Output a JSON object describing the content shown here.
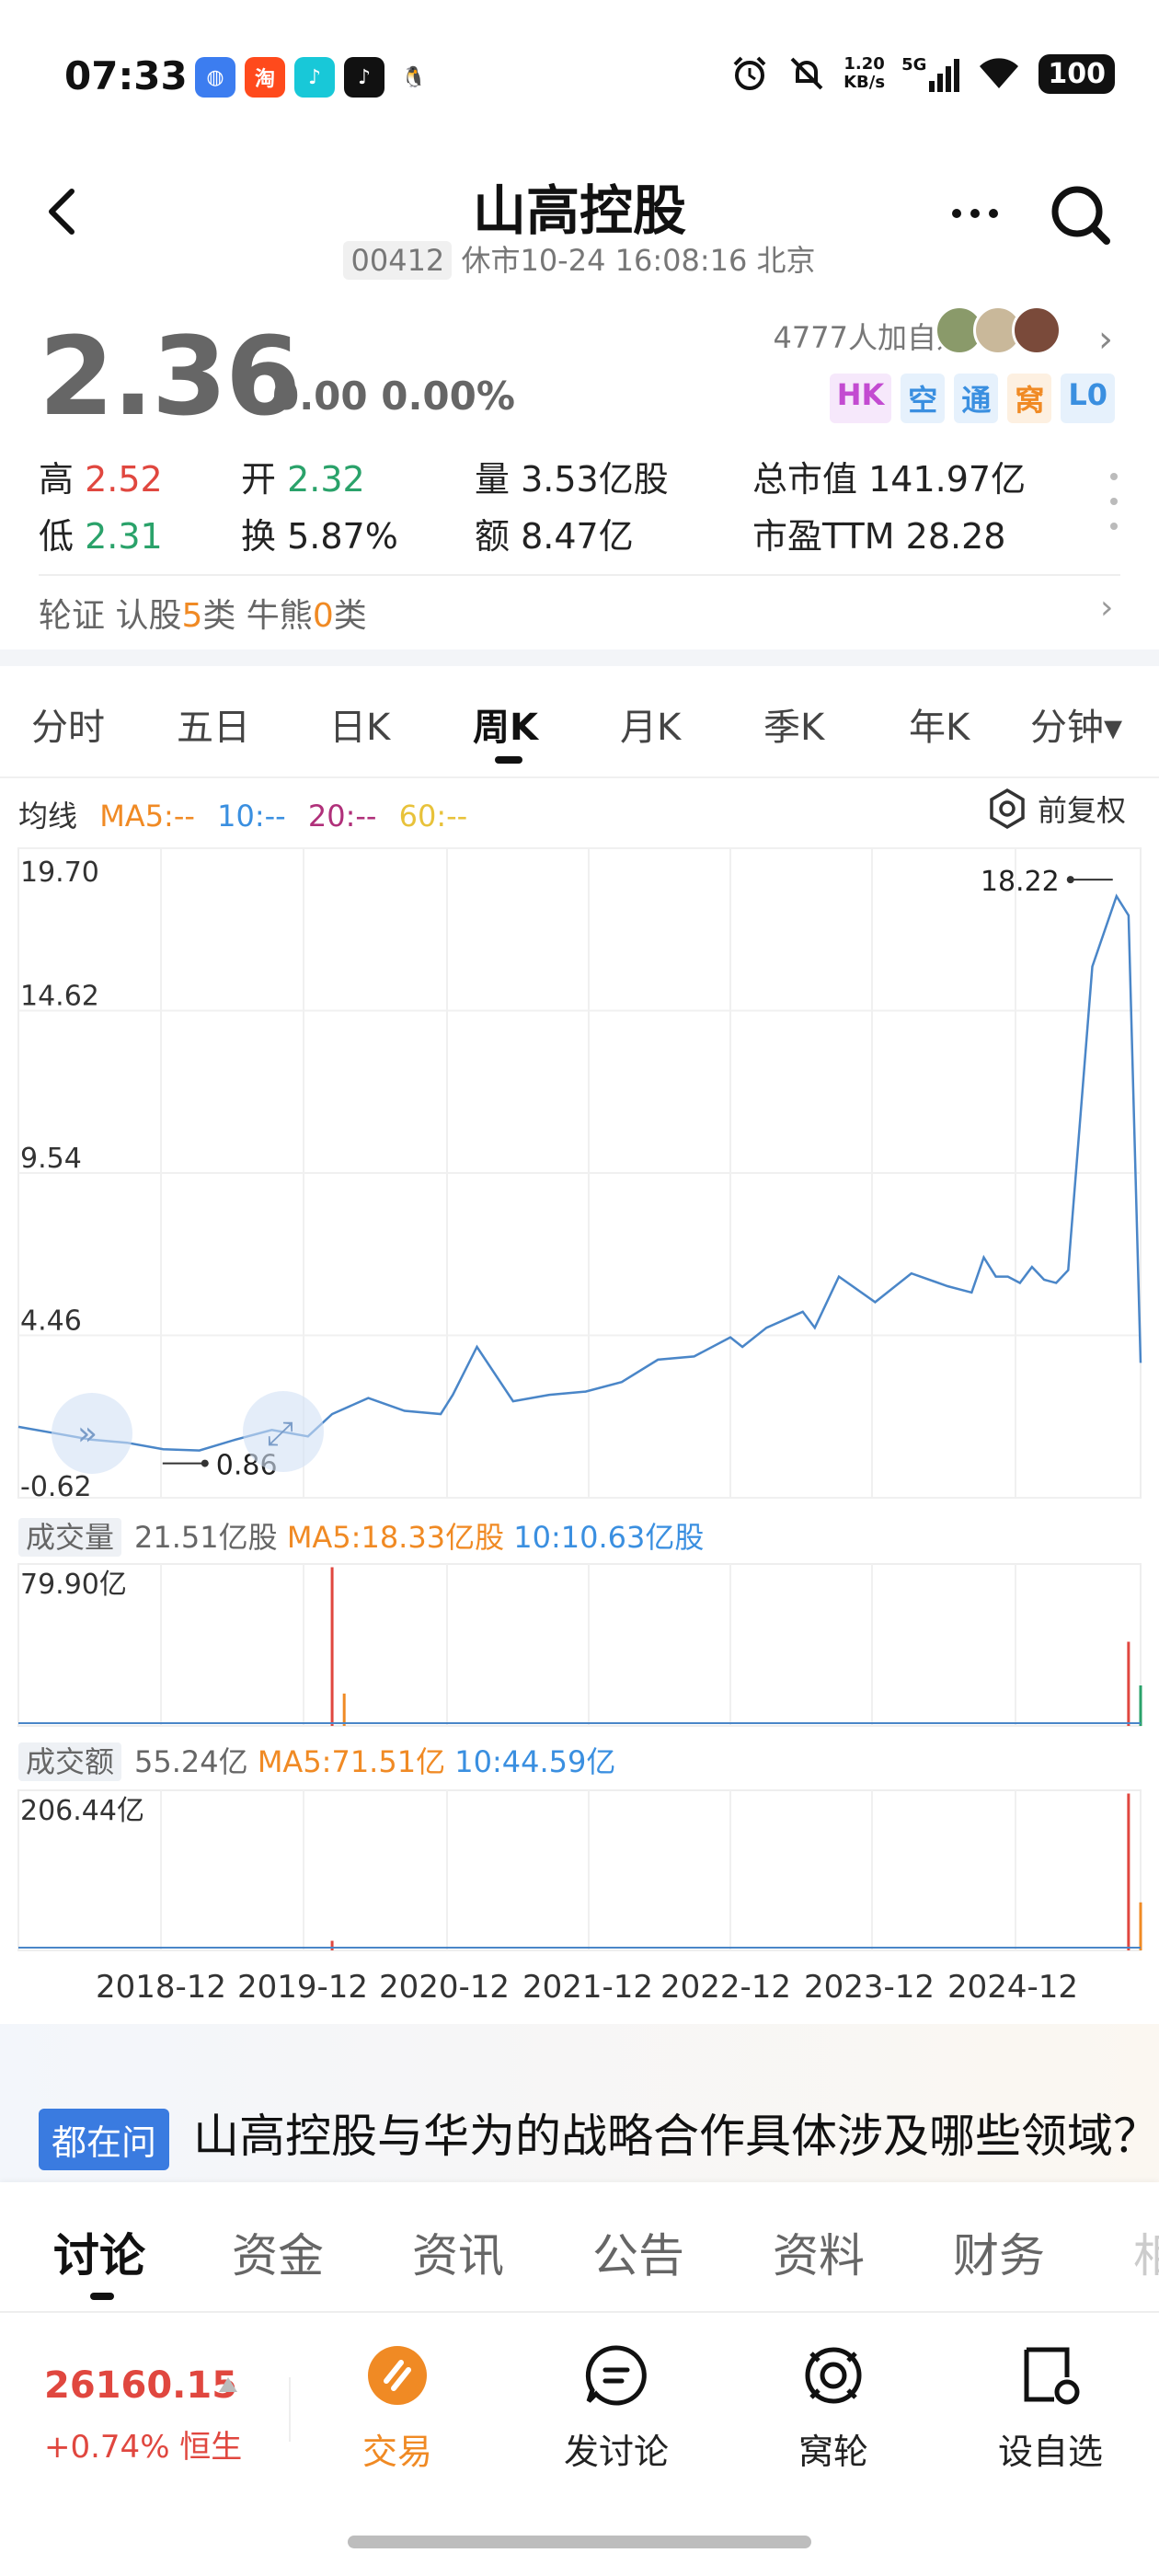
{
  "status_bar": {
    "time": "07:33",
    "app_icons": [
      "browser-icon",
      "taobao-icon",
      "tiktok-lite-icon",
      "tiktok-icon",
      "qq-icon"
    ],
    "taobao_label": "淘",
    "speed_value": "1.20",
    "speed_unit": "KB/s",
    "network": "5G",
    "battery": "100"
  },
  "header": {
    "title": "山高控股",
    "code": "00412",
    "status": "休市10-24 16:08:16 北京"
  },
  "quote": {
    "price": "2.36",
    "change": "0.00 0.00%",
    "followers": "4777人加自选",
    "badges": [
      {
        "text": "HK",
        "color": "#c34bd1",
        "bg": "#f6e8fb"
      },
      {
        "text": "空",
        "color": "#3a8fe0",
        "bg": "#e6f1fc"
      },
      {
        "text": "通",
        "color": "#3a8fe0",
        "bg": "#e6f1fc"
      },
      {
        "text": "窝",
        "color": "#f08a24",
        "bg": "#fdf0e1"
      },
      {
        "text": "L0",
        "color": "#3a8fe0",
        "bg": "#e6f1fc"
      }
    ],
    "stats": {
      "high_label": "高",
      "high_value": "2.52",
      "open_label": "开",
      "open_value": "2.32",
      "volume_label": "量",
      "volume_value": "3.53亿股",
      "market_cap_label": "总市值",
      "market_cap_value": "141.97亿",
      "low_label": "低",
      "low_value": "2.31",
      "turnover_label": "换",
      "turnover_value": "5.87%",
      "amount_label": "额",
      "amount_value": "8.47亿",
      "pe_label": "市盈TTM",
      "pe_value": "28.28"
    },
    "warrants": {
      "prefix": "轮证  认股",
      "call_count": "5",
      "call_unit": "类  牛熊",
      "cbbc_count": "0",
      "cbbc_unit": "类"
    }
  },
  "period_tabs": [
    "分时",
    "五日",
    "日K",
    "周K",
    "月K",
    "季K",
    "年K",
    "分钟▾"
  ],
  "active_period": "周K",
  "ma_legend": {
    "label": "均线",
    "ma5": "MA5:--",
    "ma10": "10:--",
    "ma20": "20:--",
    "ma60": "60:--",
    "adjust": "前复权"
  },
  "chart_data": [
    {
      "type": "line",
      "name": "price",
      "y_ticks": [
        "19.70",
        "14.62",
        "9.54",
        "4.46",
        "-0.62"
      ],
      "ylim": [
        -0.62,
        19.7
      ],
      "max_label": "18.22",
      "min_label": "0.86",
      "x_labels": [
        "2018-12",
        "2019-12",
        "2020-12",
        "2021-12",
        "2022-12",
        "2023-12",
        "2024-12"
      ],
      "x": [
        "2018-01",
        "2018-04",
        "2018-07",
        "2018-10",
        "2019-01",
        "2019-04",
        "2019-07",
        "2019-10",
        "2020-01",
        "2020-03",
        "2020-06",
        "2020-09",
        "2020-12",
        "2021-01",
        "2021-03",
        "2021-06",
        "2021-09",
        "2021-12",
        "2022-03",
        "2022-06",
        "2022-09",
        "2022-12",
        "2023-01",
        "2023-03",
        "2023-06",
        "2023-07",
        "2023-09",
        "2023-12",
        "2024-03",
        "2024-06",
        "2024-08",
        "2024-09",
        "2024-10",
        "2024-11",
        "2024-12",
        "2025-01",
        "2025-02",
        "2025-03",
        "2025-04",
        "2025-06",
        "2025-08",
        "2025-09",
        "2025-10"
      ],
      "values": [
        1.6,
        1.4,
        1.2,
        1.1,
        0.9,
        0.86,
        1.2,
        1.5,
        1.3,
        2.0,
        2.5,
        2.1,
        2.0,
        2.6,
        4.1,
        2.4,
        2.6,
        2.7,
        3.0,
        3.7,
        3.8,
        4.4,
        4.1,
        4.7,
        5.2,
        4.7,
        6.3,
        5.5,
        6.4,
        6.0,
        5.8,
        6.9,
        6.3,
        6.3,
        6.1,
        6.6,
        6.2,
        6.1,
        6.5,
        16.0,
        18.2,
        17.6,
        3.6
      ]
    },
    {
      "type": "bar",
      "name": "volume",
      "label": "成交量",
      "current": "21.51亿股",
      "ma5": "MA5:18.33亿股",
      "ma10": "10:10.63亿股",
      "y_max_label": "79.90亿",
      "ylim": [
        0,
        79.9
      ]
    },
    {
      "type": "bar",
      "name": "turnover",
      "label": "成交额",
      "current": "55.24亿",
      "ma5": "MA5:71.51亿",
      "ma10": "10:44.59亿",
      "y_max_label": "206.44亿",
      "ylim": [
        0,
        206.44
      ]
    }
  ],
  "news": {
    "tag": "都在问",
    "text": "山高控股与华为的战略合作具体涉及哪些领域？"
  },
  "bottom_tabs": [
    "讨论",
    "资金",
    "资讯",
    "公告",
    "资料",
    "财务",
    "相"
  ],
  "active_bottom_tab": "讨论",
  "index": {
    "value": "26160.15",
    "change": "+0.74% 恒生"
  },
  "toolbar": {
    "trade": "交易",
    "post": "发讨论",
    "wolun": "窝轮",
    "watch": "设自选"
  },
  "colors": {
    "up": "#e0473f",
    "down": "#2aa26a",
    "line": "#4a86c8",
    "ma5": "#f08a24",
    "ma10": "#3a8fe0",
    "ma20": "#b0307a",
    "ma60": "#e8c23a",
    "accent": "#f08a24"
  }
}
